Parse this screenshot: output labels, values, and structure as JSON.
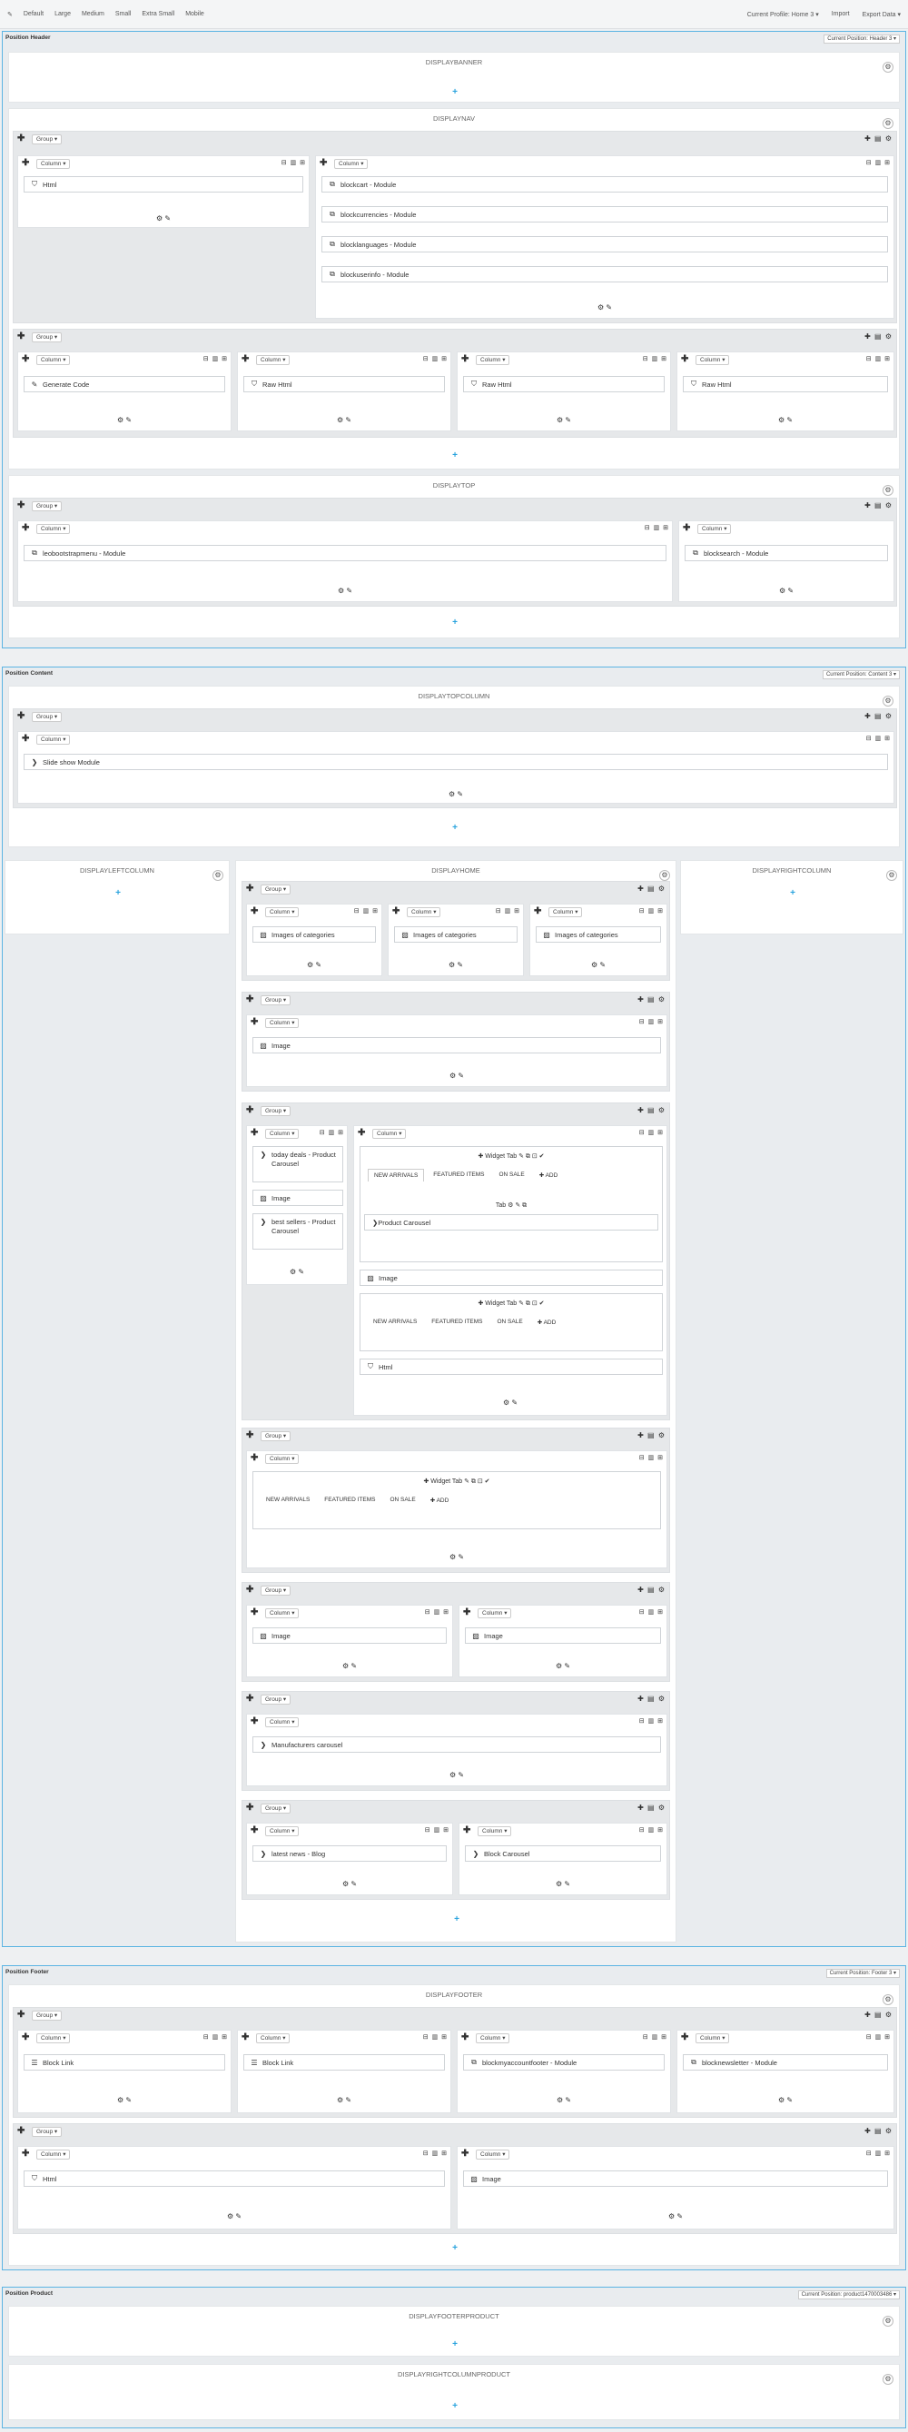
{
  "toolbar": {
    "items": [
      "Default",
      "Large",
      "Medium",
      "Small",
      "Extra Small",
      "Mobile"
    ],
    "profile": "Current Profile: Home 3 ▾",
    "import": "Import",
    "export": "Export Data ▾"
  },
  "labels": {
    "group": "Group ▾",
    "column": "Column ▾",
    "add_plus": "+",
    "col_footer": "⚙ ✎",
    "tabs": [
      "NEW ARRIVALS",
      "FEATURED ITEMS",
      "ON SALE",
      "✚ ADD"
    ]
  },
  "positions": {
    "header": {
      "title": "Position Header",
      "select": "Current Position: Header 3 ▾"
    },
    "content": {
      "title": "Position Content",
      "select": "Current Position: Content 3 ▾"
    },
    "footer": {
      "title": "Position Footer",
      "select": "Current Position: Footer 3 ▾"
    },
    "product": {
      "title": "Position Product",
      "select": "Current Position: product1470003486 ▾"
    }
  },
  "hooks": {
    "displaybanner": "DISPLAYBANNER",
    "displaynav": "DISPLAYNAV",
    "displaytop": "DISPLAYTOP",
    "displaytopcolumn": "DISPLAYTOPCOLUMN",
    "displayleftcolumn": "DISPLAYLEFTCOLUMN",
    "displayhome": "DISPLAYHOME",
    "displayrightcolumn": "DISPLAYRIGHTCOLUMN",
    "displayfooter": "DISPLAYFOOTER",
    "displayfooterproduct": "DISPLAYFOOTERPRODUCT",
    "displayrightcolumnproduct": "DISPLAYRIGHTCOLUMNPRODUCT"
  },
  "widgets": {
    "html": "Html",
    "blockcart": "blockcart - Module",
    "blockcurrencies": "blockcurrencies - Module",
    "blocklanguages": "blocklanguages - Module",
    "blockuserinfo": "blockuserinfo - Module",
    "generate_code": "Generate Code",
    "raw_html": "Raw Html",
    "leobootstrapmenu": "leobootstrapmenu - Module",
    "blocksearch": "blocksearch - Module",
    "slideshow": "Slide show Module",
    "images_of_categories": "Images of categories",
    "image": "Image",
    "today_deals": "today deals - Product Carousel",
    "best_sellers": "best sellers - Product Carousel",
    "widget_tab": "Widget Tab",
    "tab": "Tab",
    "product_carousel": "Product Carousel",
    "manufacturers": "Manufacturers carousel",
    "latest_news": "latest news - Blog",
    "block_carousel": "Block Carousel",
    "block_link": "Block Link",
    "blockmyaccountfooter": "blockmyaccountfooter - Module",
    "blocknewsletter": "blocknewsletter - Module"
  }
}
